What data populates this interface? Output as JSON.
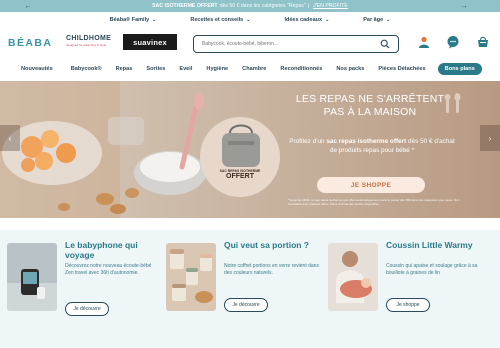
{
  "promo": {
    "bold": "SAC ISOTHERME OFFERT",
    "rest": "dès 50 € dans les catégories \"Repas\"",
    "cta": "J'EN PROFITE"
  },
  "topnav": [
    {
      "label": "Béaba® Family"
    },
    {
      "label": "Recettes et conseils"
    },
    {
      "label": "Idées cadeaux"
    },
    {
      "label": "Par âge"
    }
  ],
  "header": {
    "logo_beaba": "BÉABA",
    "logo_childhome": "CHILDHOME",
    "logo_childhome_tag": "designed for parenting in style",
    "logo_suavinex": "suavinex",
    "search_placeholder": "Babycook, écoute-bébé, biberon..."
  },
  "catnav": [
    "Nouveautés",
    "Babycook®",
    "Repas",
    "Sorties",
    "Eveil",
    "Hygiène",
    "Chambre",
    "Reconditionnés",
    "Nos packs",
    "Pièces Détachées"
  ],
  "catnav_pill": "Bons plans",
  "hero": {
    "title_line1": "LES REPAS NE S'ARRÊTENT",
    "title_line2": "PAS À LA MAISON",
    "text_pre": "Profitez d'un ",
    "text_bold": "sac repas isotherme offert",
    "text_post": " dès 50 € d'achat de produits repas pour bébé *",
    "cta": "JE SHOPPE",
    "badge_line1": "SAC REPAS ISOTHERME",
    "badge_line2": "OFFERT",
    "legal": "*Jusqu'au 16/03, un sac repas isotherme gris offert automatiquement dans le panier dès 50€ dans les catégories type repas. Non cumulable avec d'autres offres. Dans la limite des stocks disponibles."
  },
  "cards": [
    {
      "title": "Le babyphone qui voyage",
      "desc": "Découvrez notre nouveau écoute-bébé Zen travel avec 36h d'autonomie.",
      "cta": "Je découvre"
    },
    {
      "title": "Qui veut sa portion ?",
      "desc": "Notre coffret portions en verre revient dans des couleurs naturels.",
      "cta": "Je découvre"
    },
    {
      "title": "Coussin Little Warmy",
      "desc": "Coussin qui apaise et soulage grâce à sa bouillote à graines de lin",
      "cta": "Je shoppe"
    }
  ],
  "colors": {
    "promo_bg": "#8fc3c9",
    "brand": "#2b7a8a",
    "text": "#2b4a5a",
    "hero_cta_text": "#c0733f",
    "cards_bg": "#eef6f7"
  }
}
